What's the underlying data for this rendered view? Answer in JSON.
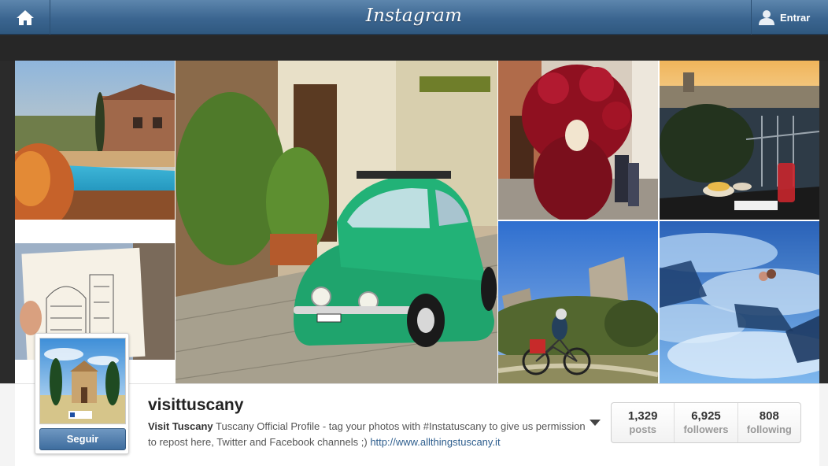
{
  "nav": {
    "logo": "Instagram",
    "login_label": "Entrar"
  },
  "profile": {
    "username": "visittuscany",
    "full_name": "Visit Tuscany",
    "bio": "Tuscany Official Profile - tag your photos with #Instatuscany to give us permission to repost here, Twitter and Facebook channels ;)",
    "website": "http://www.allthingstuscany.it",
    "follow_label": "Seguir",
    "stats": [
      {
        "value": "1,329",
        "label": "posts"
      },
      {
        "value": "6,925",
        "label": "followers"
      },
      {
        "value": "808",
        "label": "following"
      }
    ]
  },
  "photos": [
    {
      "subject": "villa-pool"
    },
    {
      "subject": "green-fiat-500"
    },
    {
      "subject": "carnival-mask"
    },
    {
      "subject": "florence-sunset-terrace"
    },
    {
      "subject": "duomo-sketch"
    },
    {
      "subject": "cyclist-tower"
    },
    {
      "subject": "thermal-spring"
    }
  ],
  "colors": {
    "nav_blue": "#3b6590",
    "follow_blue": "#3e6d9e",
    "link_blue": "#2e5e8e"
  },
  "icons": [
    "home-icon",
    "user-icon",
    "caret-down-icon"
  ]
}
